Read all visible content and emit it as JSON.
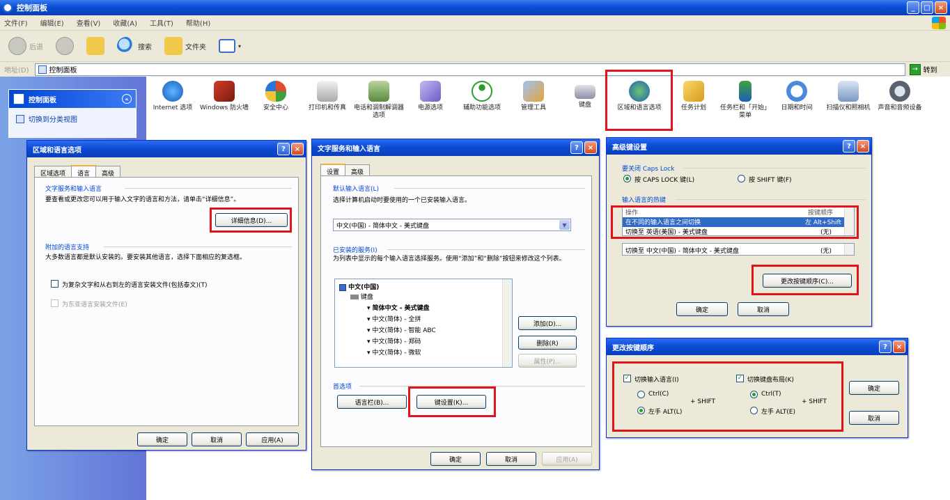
{
  "window": {
    "title": "控制面板",
    "min": "_",
    "max": "□",
    "close": "×"
  },
  "menu": [
    "文件(F)",
    "编辑(E)",
    "查看(V)",
    "收藏(A)",
    "工具(T)",
    "帮助(H)"
  ],
  "toolbar": {
    "back": "后退",
    "search": "搜索",
    "folders": "文件夹"
  },
  "address": {
    "label": "地址(D)",
    "value": "控制面板",
    "go": "转到"
  },
  "sidebar": {
    "panel_title": "控制面板",
    "switch_link": "切换到分类视图"
  },
  "cp_items": [
    {
      "label": "Internet 选项"
    },
    {
      "label": "Windows 防火墙"
    },
    {
      "label": "安全中心"
    },
    {
      "label": "打印机和传真"
    },
    {
      "label": "电话和调制解调器选项"
    },
    {
      "label": "电源选项"
    },
    {
      "label": "辅助功能选项"
    },
    {
      "label": "管理工具"
    },
    {
      "label": "键盘"
    },
    {
      "label": "区域和语言选项"
    },
    {
      "label": "任务计划"
    },
    {
      "label": "任务栏和「开始」菜单"
    },
    {
      "label": "日期和时间"
    },
    {
      "label": "扫描仪和照相机"
    },
    {
      "label": "声音和音频设备"
    }
  ],
  "dlg1": {
    "title": "区域和语言选项",
    "help": "?",
    "close": "×",
    "tabs": [
      "区域选项",
      "语言",
      "高级"
    ],
    "sec1_title": "文字服务和输入语言",
    "sec1_text": "要查看或更改您可以用于输入文字的语言和方法，请单击“详细信息”。",
    "details_btn": "详细信息(D)...",
    "sec2_title": "附加的语言支持",
    "sec2_text": "大多数语言都是默认安装的。要安装其他语言，选择下面相应的复选框。",
    "chk1": "为复杂文字和从右到左的语言安装文件(包括泰文)(T)",
    "chk2": "为东亚语言安装文件(E)",
    "ok": "确定",
    "cancel": "取消",
    "apply": "应用(A)"
  },
  "dlg2": {
    "title": "文字服务和输入语言",
    "help": "?",
    "close": "×",
    "tabs": [
      "设置",
      "高级"
    ],
    "sec1_title": "默认输入语言(L)",
    "sec1_text": "选择计算机启动时要使用的一个已安装输入语言。",
    "default_lang": "中文(中国) - 简体中文 - 美式键盘",
    "sec2_title": "已安装的服务(I)",
    "sec2_text": "为列表中显示的每个输入语言选择服务。使用“添加”和“删除”按钮来修改这个列表。",
    "tree": {
      "lang": "中文(中国)",
      "kbd": "键盘",
      "items": [
        "简体中文 - 美式键盘",
        "中文(简体) - 全拼",
        "中文(简体) - 智能 ABC",
        "中文(简体) - 郑码",
        "中文(简体) - 微软"
      ]
    },
    "add": "添加(D)...",
    "remove": "删除(R)",
    "props": "属性(P)...",
    "pref_title": "首选项",
    "langbar": "语言栏(B)...",
    "keyset": "键设置(K)...",
    "ok": "确定",
    "cancel": "取消",
    "apply": "应用(A)"
  },
  "dlg3": {
    "title": "高级键设置",
    "help": "?",
    "close": "×",
    "sec1_title": "要关闭 Caps Lock",
    "opt_caps": "按 CAPS LOCK 键(L)",
    "opt_shift": "按 SHIFT 键(F)",
    "sec2_title": "输入语言的热键",
    "col_action": "操作",
    "col_key": "按键顺序",
    "rows": [
      {
        "action": "在不同的输入语言之间切换",
        "key": "左 Alt+Shift"
      },
      {
        "action": "切换至 英语(美国) - 美式键盘",
        "key": "(无)"
      },
      {
        "action": "切换至 中文(中国) - 简体中文 - 美式键盘",
        "key": "(无)"
      }
    ],
    "change_btn": "更改按键顺序(C)...",
    "ok": "确定",
    "cancel": "取消"
  },
  "dlg4": {
    "title": "更改按键顺序",
    "help": "?",
    "close": "×",
    "chk_lang": "切换输入语言(I)",
    "chk_kbd": "切换键盘布局(K)",
    "ctrl": "Ctrl(C)",
    "alt": "左手 ALT(L)",
    "shift": "+ SHIFT",
    "ctrl2": "Ctrl(T)",
    "alt2": "左手 ALT(E)",
    "ok": "确定",
    "cancel": "取消"
  },
  "colors": {
    "titlebar": "#0a4fd6",
    "sidebar": "#6375d6",
    "highlight": "#e4131b",
    "selection": "#316ac5",
    "dialog_bg": "#ece9d8"
  }
}
